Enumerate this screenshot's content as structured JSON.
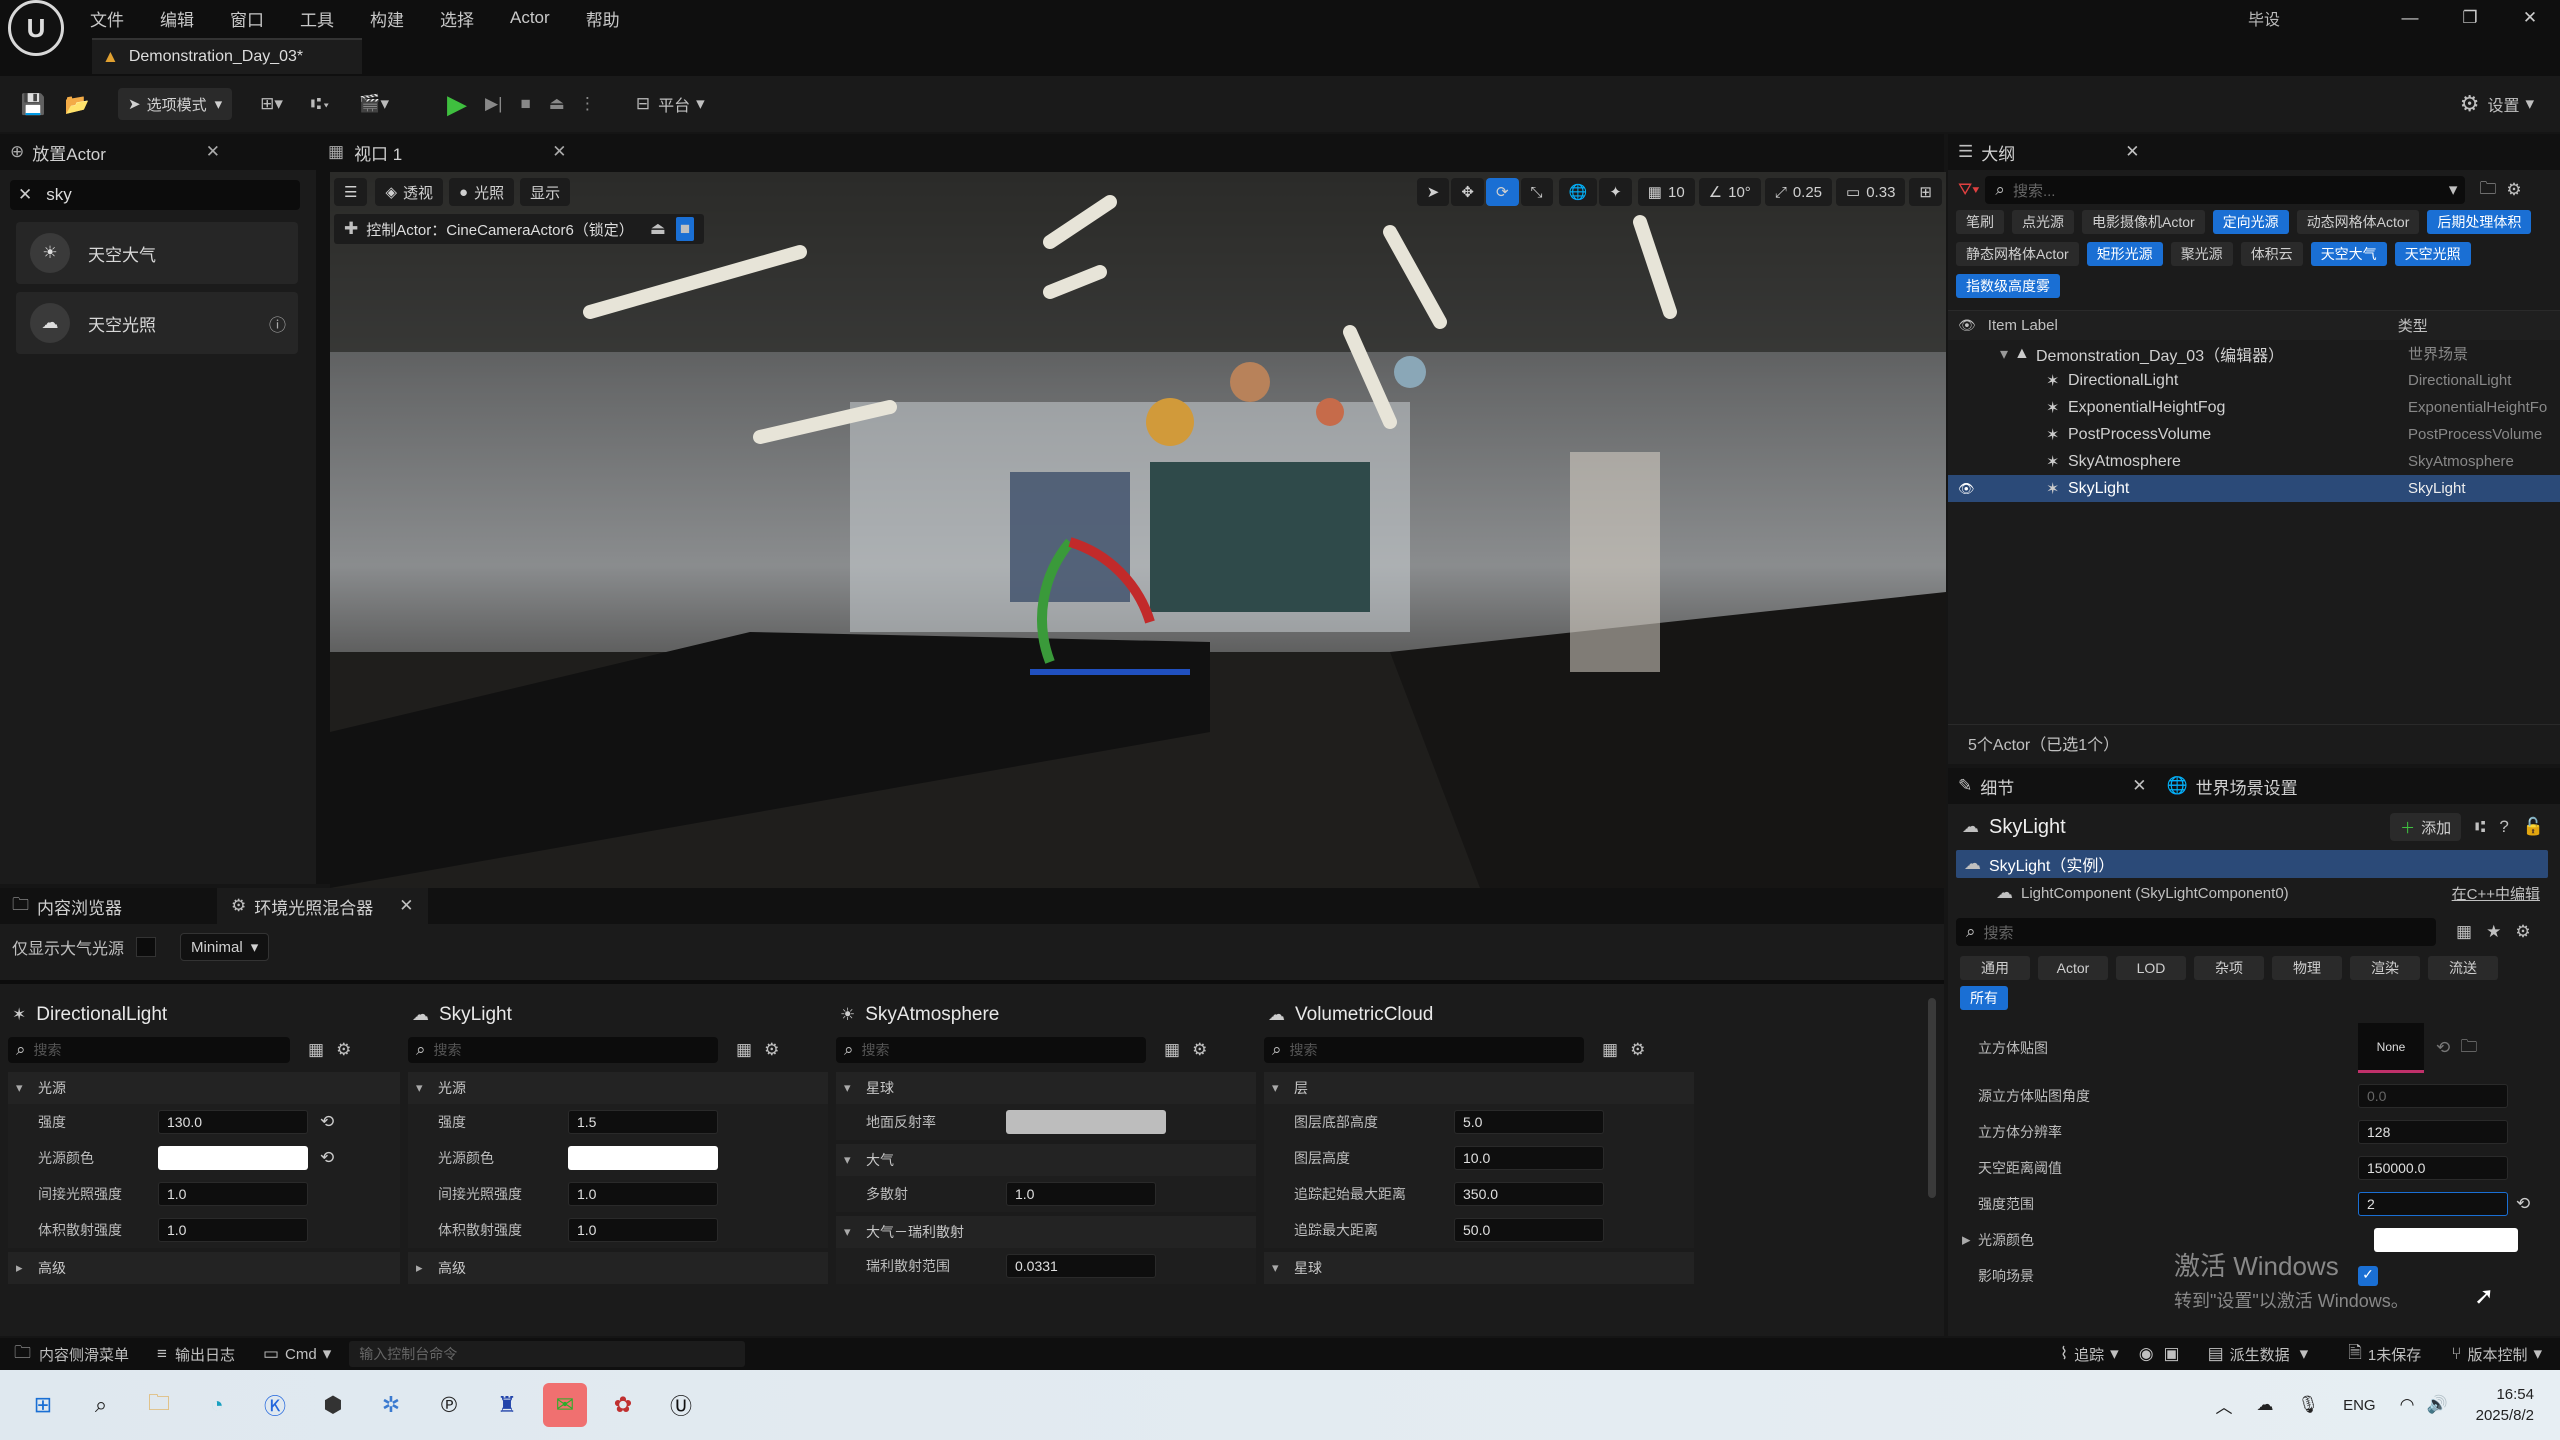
{
  "menu": {
    "items": [
      "文件",
      "编辑",
      "窗口",
      "工具",
      "构建",
      "选择",
      "Actor",
      "帮助"
    ],
    "right_label": "毕设"
  },
  "doc_tab": {
    "title": "Demonstration_Day_03*"
  },
  "toolbar": {
    "mode_label": "选项模式",
    "platform_label": "平台",
    "settings_label": "设置"
  },
  "place_actors": {
    "tab": "放置Actor",
    "search_value": "sky",
    "items": [
      {
        "label": "天空大气"
      },
      {
        "label": "天空光照"
      }
    ]
  },
  "viewport": {
    "tab": "视口 1",
    "perspective": "透视",
    "lit": "光照",
    "show": "显示",
    "pilot_label": "控制Actor：CineCameraActor6（锁定）",
    "grid_value": "10",
    "angle_value": "10°",
    "scale_value": "0.25",
    "camera_speed": "0.33"
  },
  "outliner": {
    "tab": "大纲",
    "search_placeholder": "搜索...",
    "filter_chips": [
      {
        "label": "笔刷",
        "on": false
      },
      {
        "label": "点光源",
        "on": false
      },
      {
        "label": "电影摄像机Actor",
        "on": false
      },
      {
        "label": "定向光源",
        "on": true
      },
      {
        "label": "动态网格体Actor",
        "on": false
      },
      {
        "label": "后期处理体积",
        "on": true
      },
      {
        "label": "静态网格体Actor",
        "on": false
      },
      {
        "label": "矩形光源",
        "on": true
      },
      {
        "label": "聚光源",
        "on": false
      },
      {
        "label": "体积云",
        "on": false
      },
      {
        "label": "天空大气",
        "on": true
      },
      {
        "label": "天空光照",
        "on": true
      },
      {
        "label": "指数级高度雾",
        "on": true
      }
    ],
    "col_label": "Item Label",
    "col_type": "类型",
    "rows": [
      {
        "label": "Demonstration_Day_03（编辑器）",
        "type": "世界场景",
        "indent": 0,
        "sel": false
      },
      {
        "label": "DirectionalLight",
        "type": "DirectionalLight",
        "indent": 1,
        "sel": false
      },
      {
        "label": "ExponentialHeightFog",
        "type": "ExponentialHeightFo",
        "indent": 1,
        "sel": false
      },
      {
        "label": "PostProcessVolume",
        "type": "PostProcessVolume",
        "indent": 1,
        "sel": false
      },
      {
        "label": "SkyAtmosphere",
        "type": "SkyAtmosphere",
        "indent": 1,
        "sel": false
      },
      {
        "label": "SkyLight",
        "type": "SkyLight",
        "indent": 1,
        "sel": true
      }
    ],
    "count_text": "5个Actor（已选1个）"
  },
  "details": {
    "tab": "细节",
    "tab2": "世界场景设置",
    "actor_name": "SkyLight",
    "add_label": "添加",
    "instance_label": "SkyLight（实例）",
    "component_label": "LightComponent (SkyLightComponent0)",
    "edit_cpp": "在C++中编辑",
    "search_placeholder": "搜索",
    "cats": [
      {
        "label": "通用",
        "on": false
      },
      {
        "label": "Actor",
        "on": false
      },
      {
        "label": "LOD",
        "on": false
      },
      {
        "label": "杂项",
        "on": false
      },
      {
        "label": "物理",
        "on": false
      },
      {
        "label": "渲染",
        "on": false
      },
      {
        "label": "流送",
        "on": false
      }
    ],
    "all_label": "所有",
    "cubemap_label": "立方体贴图",
    "cubemap_none": "None",
    "props": [
      {
        "label": "源立方体贴图角度",
        "value": "0.0"
      },
      {
        "label": "立方体分辨率",
        "value": "128"
      },
      {
        "label": "天空距离阈值",
        "value": "150000.0"
      },
      {
        "label": "强度范围",
        "value": "2"
      },
      {
        "label": "光源颜色",
        "value": ""
      },
      {
        "label": "影响场景",
        "value": ""
      }
    ],
    "watermark_line1": "激活 Windows",
    "watermark_line2": "转到\"设置\"以激活 Windows。"
  },
  "content_tabs": {
    "tab1": "内容浏览器",
    "tab2": "环境光照混合器"
  },
  "env_mixer": {
    "only_atmo_label": "仅显示大气光源",
    "preset": "Minimal",
    "search_placeholder": "搜索",
    "cols": [
      {
        "title": "DirectionalLight",
        "sections": [
          {
            "name": "光源",
            "open": true,
            "rows": [
              {
                "label": "强度",
                "value": "130.0",
                "reset": true
              },
              {
                "label": "光源颜色",
                "value": "",
                "color": true,
                "reset": true
              },
              {
                "label": "间接光照强度",
                "value": "1.0"
              },
              {
                "label": "体积散射强度",
                "value": "1.0"
              }
            ]
          },
          {
            "name": "高级",
            "open": false,
            "rows": []
          }
        ]
      },
      {
        "title": "SkyLight",
        "sections": [
          {
            "name": "光源",
            "open": true,
            "rows": [
              {
                "label": "强度",
                "value": "1.5"
              },
              {
                "label": "光源颜色",
                "value": "",
                "color": true
              },
              {
                "label": "间接光照强度",
                "value": "1.0"
              },
              {
                "label": "体积散射强度",
                "value": "1.0"
              }
            ]
          },
          {
            "name": "高级",
            "open": false,
            "rows": []
          }
        ]
      },
      {
        "title": "SkyAtmosphere",
        "sections": [
          {
            "name": "星球",
            "open": true,
            "rows": [
              {
                "label": "地面反射率",
                "value": "",
                "gray": true
              }
            ]
          },
          {
            "name": "大气",
            "open": true,
            "rows": [
              {
                "label": "多散射",
                "value": "1.0"
              }
            ]
          },
          {
            "name": "大气－瑞利散射",
            "open": true,
            "rows": [
              {
                "label": "瑞利散射范围",
                "value": "0.0331"
              }
            ]
          }
        ]
      },
      {
        "title": "VolumetricCloud",
        "sections": [
          {
            "name": "层",
            "open": true,
            "rows": [
              {
                "label": "图层底部高度",
                "value": "5.0"
              },
              {
                "label": "图层高度",
                "value": "10.0"
              },
              {
                "label": "追踪起始最大距离",
                "value": "350.0"
              },
              {
                "label": "追踪最大距离",
                "value": "50.0"
              }
            ]
          },
          {
            "name": "星球",
            "open": true,
            "rows": []
          }
        ]
      }
    ]
  },
  "statusbar": {
    "drawer": "内容侧滑菜单",
    "log": "输出日志",
    "cmd": "Cmd",
    "cmd_placeholder": "输入控制台命令",
    "trace": "追踪",
    "derived": "派生数据",
    "unsaved": "1未保存",
    "source_control": "版本控制"
  },
  "taskbar": {
    "lang": "ENG",
    "time": "16:54",
    "date": "2025/8/2"
  },
  "colors": {
    "accent": "#1a6fd4",
    "play": "#3fbf3f",
    "selected_row": "#2b4a78"
  }
}
